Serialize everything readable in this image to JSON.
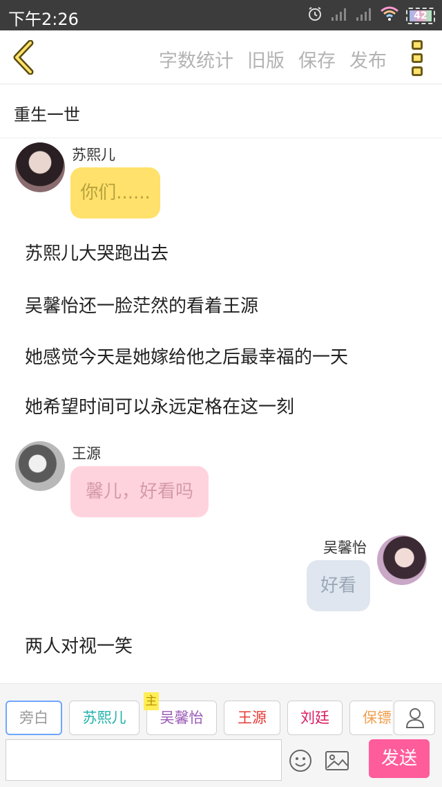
{
  "status_bar": {
    "time": "下午2:26",
    "battery": "42"
  },
  "toolbar": {
    "word_count": "字数统计",
    "old_version": "旧版",
    "save": "保存",
    "publish": "发布"
  },
  "story_title": "重生一世",
  "messages": [
    {
      "speaker": "苏熙儿",
      "text": "你们......",
      "bubble_color": "#ffe16b",
      "text_color": "#b8a23e"
    },
    {
      "speaker": "王源",
      "text": "馨儿，好看吗",
      "bubble_color": "#ffd3dd",
      "text_color": "#d49aa9"
    },
    {
      "speaker": "吴馨怡",
      "text": "好看",
      "bubble_color": "#dfe6ef",
      "text_color": "#9aa7b7"
    }
  ],
  "narrations": [
    "苏熙儿大哭跑出去",
    "吴馨怡还一脸茫然的看着王源",
    "她感觉今天是她嫁给他之后最幸福的一天",
    "她希望时间可以永远定格在这一刻",
    "两人对视一笑"
  ],
  "characters": [
    {
      "label": "旁白",
      "color": "#9a9a9a"
    },
    {
      "label": "苏熙儿",
      "color": "#20b2aa"
    },
    {
      "label": "吴馨怡",
      "color": "#9b59b6"
    },
    {
      "label": "王源",
      "color": "#e53935"
    },
    {
      "label": "刘廷",
      "color": "#d81b60"
    },
    {
      "label": "保镖",
      "color": "#f0a050"
    }
  ],
  "main_tag": "主",
  "input": {
    "value": "",
    "placeholder": ""
  },
  "send_label": "发送",
  "colors": {
    "accent": "#ff5c9c",
    "active_chip_border": "#6ea6ff"
  }
}
